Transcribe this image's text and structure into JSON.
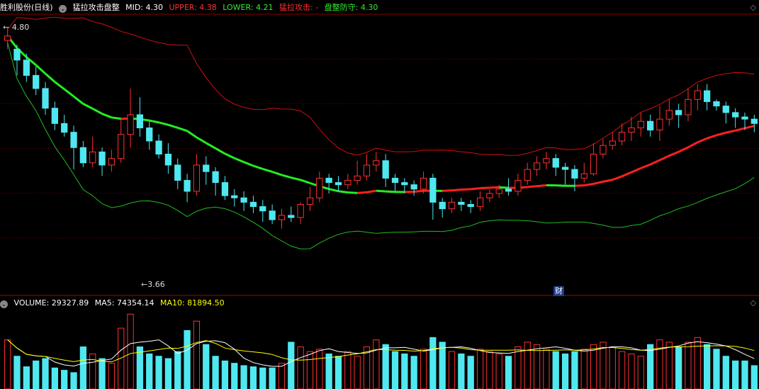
{
  "header": {
    "title": "胜利股份(日线)",
    "indicator_name": "猛拉攻击盘整",
    "mid_label": "MID: 4.30",
    "upper_label": "UPPER: 4.38",
    "lower_label": "LOWER: 4.21",
    "attack_label": "猛拉攻击: -",
    "defend_label": "盘整防守: 4.30",
    "colors": {
      "mid": "#ffffff",
      "upper": "#ff3030",
      "lower": "#33ee33",
      "attack": "#ff3030",
      "defend": "#33ee33"
    }
  },
  "volume_header": {
    "volume_label": "VOLUME: 29327.89",
    "ma5_label": "MA5: 74354.14",
    "ma10_label": "MA10: 81894.50",
    "colors": {
      "volume": "#ffffff",
      "ma5": "#ffffff",
      "ma10": "#ffff00"
    }
  },
  "chart_data": {
    "type": "candlestick",
    "price_marks": {
      "high": "4.80",
      "low": "3.66"
    },
    "event_badge": "财",
    "colors": {
      "up": "#ff3030",
      "down": "#4fe8f0",
      "upper_band": "#cc1010",
      "lower_band": "#22bb22",
      "mid_up": "#ff2020",
      "mid_down": "#22ee22",
      "ma5": "#ffffff",
      "ma10": "#ffff00",
      "grid": "#8a0000"
    },
    "candles": [
      [
        4.74,
        4.76,
        4.7,
        4.8
      ],
      [
        4.7,
        4.65,
        4.58,
        4.72
      ],
      [
        4.65,
        4.58,
        4.55,
        4.68
      ],
      [
        4.58,
        4.52,
        4.49,
        4.62
      ],
      [
        4.52,
        4.43,
        4.4,
        4.55
      ],
      [
        4.43,
        4.36,
        4.33,
        4.46
      ],
      [
        4.36,
        4.32,
        4.3,
        4.4
      ],
      [
        4.32,
        4.25,
        4.15,
        4.35
      ],
      [
        4.25,
        4.18,
        4.16,
        4.28
      ],
      [
        4.18,
        4.23,
        4.16,
        4.3
      ],
      [
        4.23,
        4.17,
        4.12,
        4.25
      ],
      [
        4.17,
        4.2,
        4.14,
        4.24
      ],
      [
        4.2,
        4.31,
        4.18,
        4.38
      ],
      [
        4.31,
        4.4,
        4.25,
        4.52
      ],
      [
        4.4,
        4.34,
        4.3,
        4.48
      ],
      [
        4.34,
        4.28,
        4.24,
        4.37
      ],
      [
        4.28,
        4.22,
        4.2,
        4.31
      ],
      [
        4.22,
        4.17,
        4.13,
        4.27
      ],
      [
        4.17,
        4.1,
        4.06,
        4.2
      ],
      [
        4.1,
        4.05,
        4.0,
        4.13
      ],
      [
        4.05,
        4.17,
        4.03,
        4.22
      ],
      [
        4.17,
        4.14,
        4.08,
        4.21
      ],
      [
        4.14,
        4.09,
        4.03,
        4.16
      ],
      [
        4.09,
        4.03,
        4.01,
        4.12
      ],
      [
        4.03,
        4.02,
        3.98,
        4.06
      ],
      [
        4.02,
        4.0,
        3.96,
        4.05
      ],
      [
        4.0,
        3.98,
        3.95,
        4.03
      ],
      [
        3.98,
        3.96,
        3.91,
        4.01
      ],
      [
        3.96,
        3.92,
        3.9,
        3.99
      ],
      [
        3.92,
        3.94,
        3.88,
        3.97
      ],
      [
        3.94,
        3.93,
        3.91,
        3.98
      ],
      [
        3.93,
        3.99,
        3.9,
        4.0
      ],
      [
        3.99,
        4.02,
        3.96,
        4.07
      ],
      [
        4.02,
        4.11,
        4.0,
        4.14
      ],
      [
        4.11,
        4.09,
        4.04,
        4.13
      ],
      [
        4.09,
        4.08,
        4.05,
        4.12
      ],
      [
        4.08,
        4.1,
        4.06,
        4.13
      ],
      [
        4.1,
        4.12,
        4.08,
        4.19
      ],
      [
        4.12,
        4.17,
        4.1,
        4.22
      ],
      [
        4.17,
        4.19,
        4.14,
        4.23
      ],
      [
        4.19,
        4.11,
        4.07,
        4.22
      ],
      [
        4.11,
        4.09,
        4.05,
        4.13
      ],
      [
        4.09,
        4.08,
        4.04,
        4.11
      ],
      [
        4.08,
        4.06,
        4.03,
        4.1
      ],
      [
        4.06,
        4.11,
        4.04,
        4.14
      ],
      [
        4.11,
        4.0,
        3.92,
        4.13
      ],
      [
        4.0,
        3.97,
        3.93,
        4.02
      ],
      [
        3.97,
        4.0,
        3.95,
        4.02
      ],
      [
        4.0,
        3.99,
        3.96,
        4.02
      ],
      [
        3.99,
        3.98,
        3.95,
        4.01
      ],
      [
        3.98,
        4.02,
        3.96,
        4.05
      ],
      [
        4.02,
        4.04,
        4.0,
        4.06
      ],
      [
        4.04,
        4.06,
        4.02,
        4.08
      ],
      [
        4.06,
        4.05,
        4.03,
        4.11
      ],
      [
        4.05,
        4.1,
        4.03,
        4.13
      ],
      [
        4.1,
        4.15,
        4.08,
        4.18
      ],
      [
        4.15,
        4.18,
        4.12,
        4.21
      ],
      [
        4.18,
        4.2,
        4.15,
        4.23
      ],
      [
        4.2,
        4.16,
        4.12,
        4.22
      ],
      [
        4.16,
        4.15,
        4.08,
        4.18
      ],
      [
        4.15,
        4.11,
        4.05,
        4.17
      ],
      [
        4.11,
        4.13,
        4.09,
        4.18
      ],
      [
        4.13,
        4.22,
        4.12,
        4.27
      ],
      [
        4.22,
        4.26,
        4.2,
        4.29
      ],
      [
        4.26,
        4.28,
        4.24,
        4.32
      ],
      [
        4.28,
        4.32,
        4.26,
        4.36
      ],
      [
        4.32,
        4.34,
        4.28,
        4.39
      ],
      [
        4.34,
        4.37,
        4.3,
        4.41
      ],
      [
        4.37,
        4.33,
        4.3,
        4.4
      ],
      [
        4.33,
        4.38,
        4.28,
        4.44
      ],
      [
        4.38,
        4.42,
        4.35,
        4.47
      ],
      [
        4.42,
        4.4,
        4.34,
        4.45
      ],
      [
        4.4,
        4.47,
        4.37,
        4.52
      ],
      [
        4.47,
        4.51,
        4.42,
        4.54
      ],
      [
        4.51,
        4.46,
        4.42,
        4.54
      ],
      [
        4.46,
        4.44,
        4.42,
        4.47
      ],
      [
        4.44,
        4.41,
        4.36,
        4.46
      ],
      [
        4.41,
        4.39,
        4.34,
        4.43
      ],
      [
        4.39,
        4.38,
        4.33,
        4.41
      ],
      [
        4.38,
        4.36,
        4.32,
        4.4
      ]
    ],
    "volume": [
      210,
      140,
      95,
      120,
      130,
      90,
      80,
      70,
      180,
      150,
      130,
      110,
      260,
      320,
      180,
      150,
      140,
      130,
      160,
      250,
      290,
      190,
      140,
      120,
      110,
      100,
      95,
      90,
      90,
      110,
      200,
      180,
      160,
      170,
      150,
      140,
      160,
      140,
      180,
      210,
      190,
      160,
      150,
      140,
      170,
      220,
      200,
      160,
      150,
      140,
      170,
      160,
      150,
      140,
      180,
      200,
      190,
      170,
      160,
      150,
      160,
      170,
      190,
      200,
      180,
      160,
      150,
      140,
      190,
      210,
      200,
      180,
      200,
      220,
      190,
      170,
      140,
      120,
      120,
      100
    ],
    "ylim": [
      3.58,
      4.86
    ]
  }
}
